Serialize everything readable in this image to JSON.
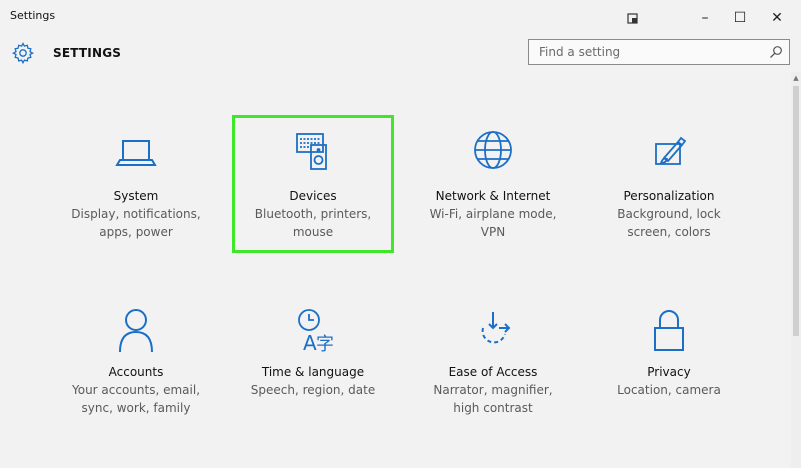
{
  "window": {
    "title": "Settings",
    "controls": {
      "snap_icon": "snap-icon",
      "minimize": "–",
      "maximize": "☐",
      "close": "✕"
    }
  },
  "header": {
    "title": "SETTINGS",
    "search_placeholder": "Find a setting"
  },
  "colors": {
    "accent": "#1c6fc6",
    "highlight": "#3fe62a",
    "background": "#f2f2f2"
  },
  "tiles": [
    {
      "id": "system",
      "icon": "laptop-icon",
      "name": "System",
      "desc": "Display, notifications,\napps, power"
    },
    {
      "id": "devices",
      "icon": "devices-icon",
      "name": "Devices",
      "desc": "Bluetooth, printers,\nmouse"
    },
    {
      "id": "network",
      "icon": "globe-icon",
      "name": "Network & Internet",
      "desc": "Wi-Fi, airplane mode,\nVPN"
    },
    {
      "id": "personalization",
      "icon": "paint-icon",
      "name": "Personalization",
      "desc": "Background, lock\nscreen, colors"
    },
    {
      "id": "accounts",
      "icon": "person-icon",
      "name": "Accounts",
      "desc": "Your accounts, email,\nsync, work, family"
    },
    {
      "id": "time",
      "icon": "time-language-icon",
      "name": "Time & language",
      "desc": "Speech, region, date"
    },
    {
      "id": "ease",
      "icon": "ease-of-access-icon",
      "name": "Ease of Access",
      "desc": "Narrator, magnifier,\nhigh contrast"
    },
    {
      "id": "privacy",
      "icon": "lock-icon",
      "name": "Privacy",
      "desc": "Location, camera"
    }
  ]
}
